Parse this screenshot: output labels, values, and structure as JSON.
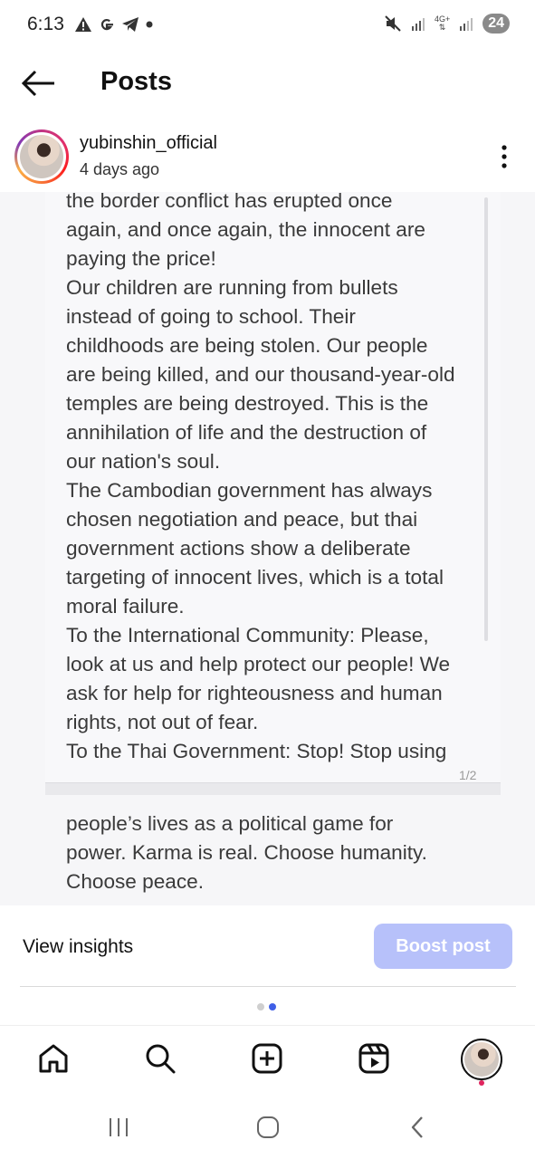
{
  "status_bar": {
    "time": "6:13",
    "left_icons": [
      "warning-icon",
      "google-icon",
      "telegram-icon",
      "dot-icon"
    ],
    "network_label": "4G+",
    "battery": "24"
  },
  "header": {
    "title": "Posts"
  },
  "post": {
    "username": "yubinshin_official",
    "time_ago": "4 days ago",
    "image_text_page1": "the border conflict has erupted once\nagain, and once again, the innocent are\npaying the price!\nOur children are running from bullets\ninstead of going to school. Their\nchildhoods are being stolen. Our people\nare being killed, and our thousand-year-old\ntemples are being destroyed. This is the\nannihilation of life and the destruction of\nour nation's soul.\nThe Cambodian government has always\nchosen negotiation and peace, but thai\ngovernment  actions show a deliberate\ntargeting of innocent lives, which is a total\nmoral failure.\nTo the International Community: Please,\nlook at us and help protect our people! We\nask for help for righteousness and human\nrights, not out of fear.\nTo the Thai Government: Stop! Stop using",
    "page_indicator": "1/2",
    "image_text_page2": "people’s lives as a political game for\npower. Karma is real. Choose humanity.\nChoose peace."
  },
  "actions": {
    "view_insights": "View insights",
    "boost_post": "Boost post"
  },
  "colors": {
    "boost_button": "#b7c1fa",
    "active_dot": "#3f5fe6",
    "notification_dot": "#e0245e"
  },
  "bottom_nav": {
    "items": [
      "home-icon",
      "search-icon",
      "create-icon",
      "reels-icon",
      "profile-avatar"
    ]
  },
  "android_nav": {
    "items": [
      "recent-apps-icon",
      "home-button-icon",
      "back-icon"
    ]
  }
}
